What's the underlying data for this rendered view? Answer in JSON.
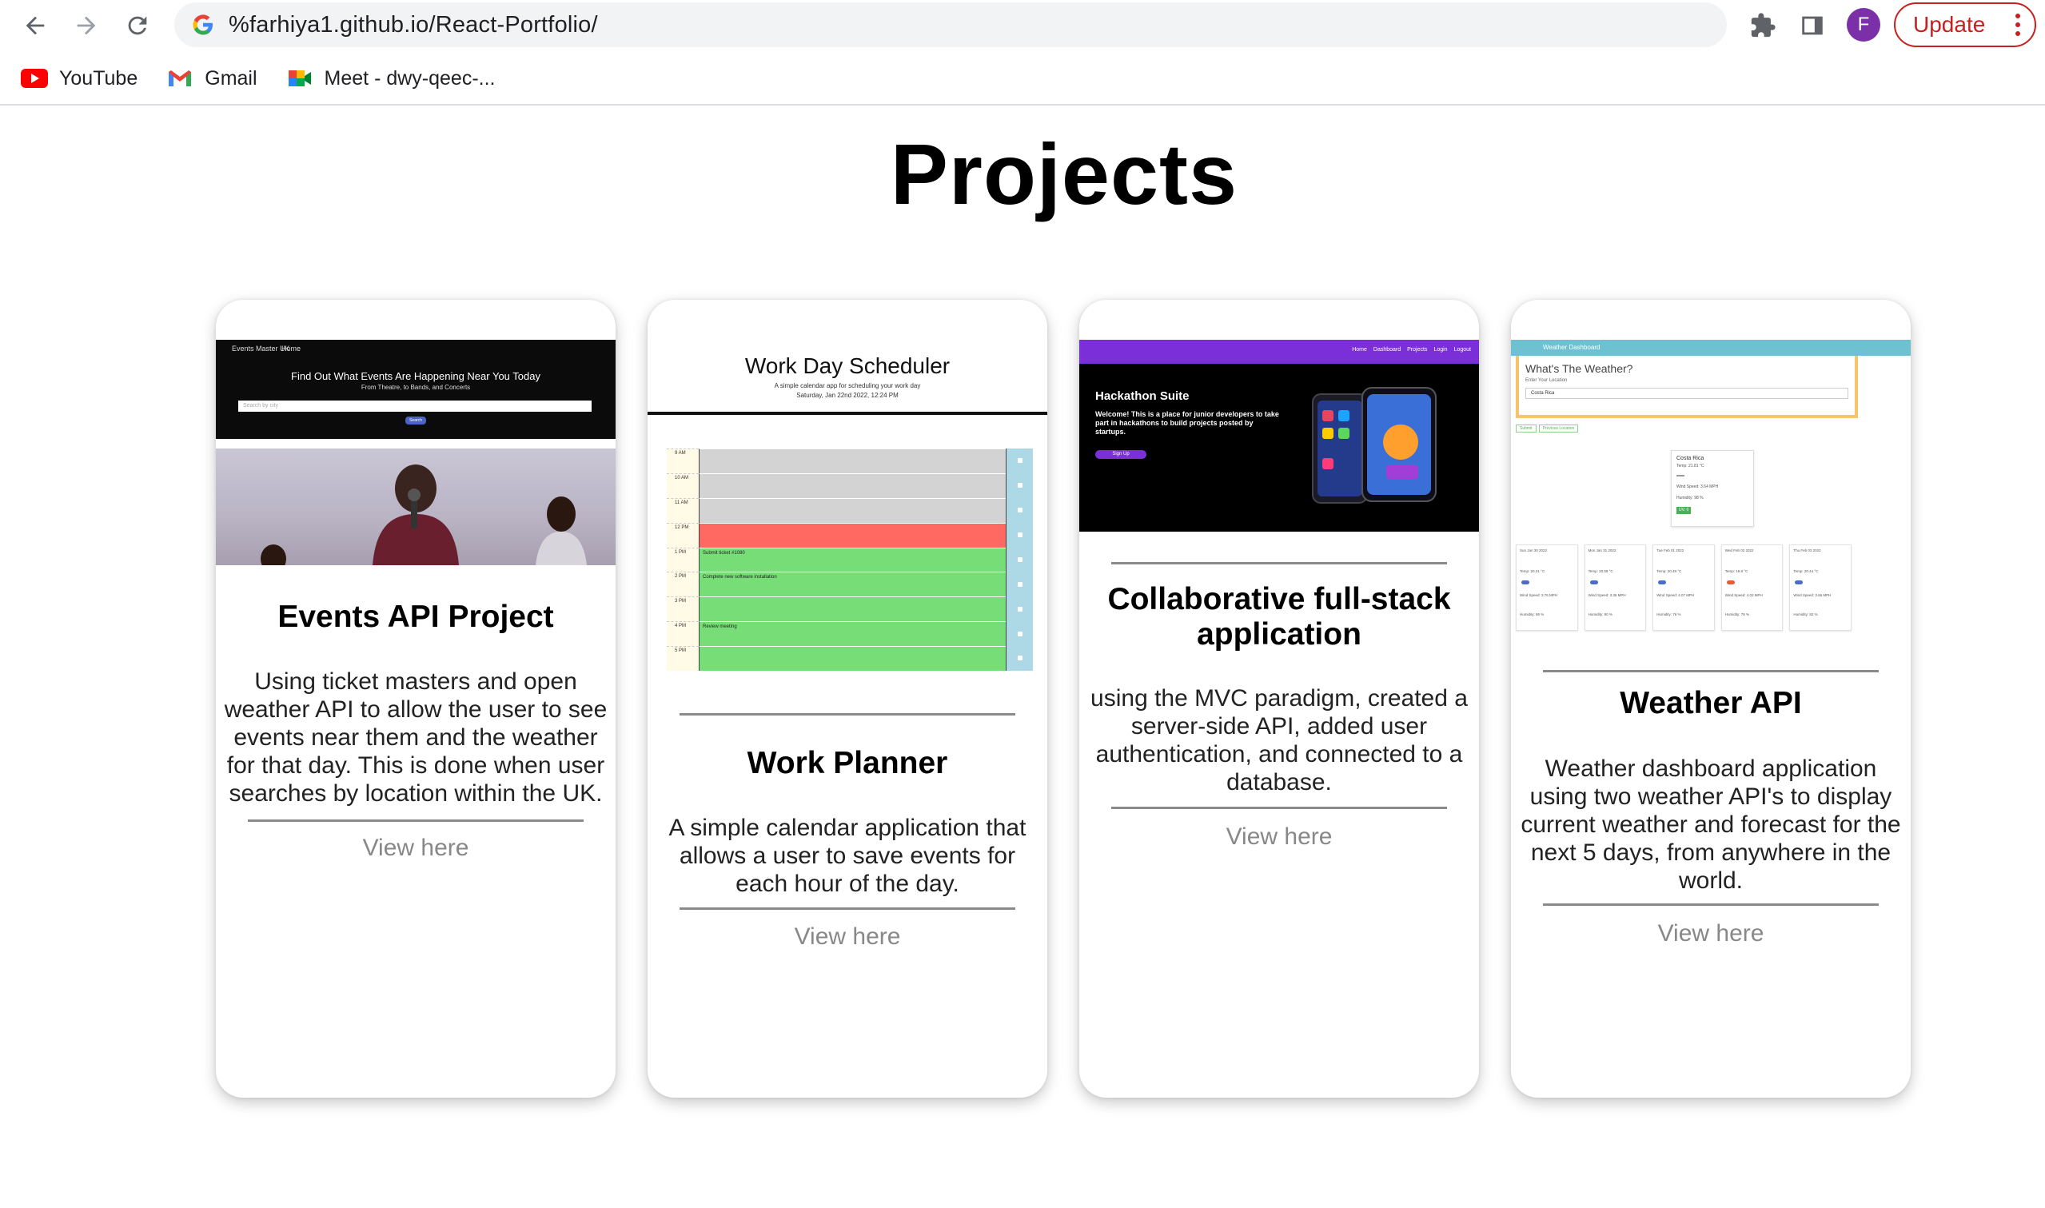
{
  "browser": {
    "url": "%farhiya1.github.io/React-Portfolio/",
    "update_label": "Update",
    "avatar_letter": "F",
    "bookmarks": [
      {
        "label": "YouTube"
      },
      {
        "label": "Gmail"
      },
      {
        "label": "Meet - dwy-qeec-..."
      }
    ]
  },
  "page": {
    "title": "Projects"
  },
  "projects": [
    {
      "title": "Events API Project",
      "description": "Using ticket masters and open weather API to allow the user to see events near them and the weather for that day. This is done when user searches by location within the UK.",
      "link_label": "View here",
      "preview": {
        "nav_brand": "Events Master UK",
        "nav_home": "Home",
        "heading": "Find Out What Events Are Happening Near You Today",
        "subheading": "From Theatre, to Bands, and Concerts",
        "search_placeholder": "Search by city",
        "button": "Search"
      }
    },
    {
      "title": "Work Planner",
      "description": "A simple calendar application that allows a user to save events for each hour of the day.",
      "link_label": "View here",
      "preview": {
        "heading": "Work Day Scheduler",
        "subheading": "A simple calendar app for scheduling your work day",
        "date": "Saturday, Jan 22nd 2022, 12:24 PM",
        "hours": [
          "9 AM",
          "10 AM",
          "11 AM",
          "12 PM",
          "1 PM",
          "2 PM",
          "3 PM",
          "4 PM",
          "5 PM"
        ],
        "events": [
          "",
          "",
          "",
          "",
          "Submit ticket #1080",
          "Complete new software installation",
          "",
          "Review meeting",
          ""
        ],
        "colors": {
          "past": "#d3d3d3",
          "present": "#ff6961",
          "future": "#77dd77",
          "save": "#add8e6"
        }
      }
    },
    {
      "title": "Collaborative full-stack application",
      "description": "using the MVC paradigm, created a server-side API, added user authentication, and connected to a database.",
      "link_label": "View here",
      "preview": {
        "nav_links": [
          "Home",
          "Dashboard",
          "Projects",
          "Login",
          "Logout"
        ],
        "heading": "Hackathon Suite",
        "body": "Welcome! This is a place for junior developers to take part in hackathons to build projects posted by startups.",
        "button": "Sign Up",
        "accent": "#7b2fd8"
      }
    },
    {
      "title": "Weather API",
      "description": "Weather dashboard application using two weather API's to display current weather and forecast for the next 5 days, from anywhere in the world.",
      "link_label": "View here",
      "preview": {
        "nav_title": "Weather Dashboard",
        "heading": "What's The Weather?",
        "input_label": "Enter Your Location",
        "input_value": "Costa Rica",
        "buttons": [
          "Submit",
          "Previous Location"
        ],
        "current_city": "Costa Rica",
        "current_lines": [
          "Temp: 21.81 °C",
          "Wind Speed: 3.64 MPH",
          "Humidity: 98 %"
        ],
        "uv_label": "UV: 0",
        "forecast": [
          {
            "date": "Sun Jan 30 2022",
            "temp": "Temp: 20.31 °C",
            "wind": "Wind Speed: 3.76 MPH",
            "hum": "Humidity: 86 %"
          },
          {
            "date": "Mon Jan 31 2022",
            "temp": "Temp: 20.59 °C",
            "wind": "Wind Speed: 3.36 MPH",
            "hum": "Humidity: 80 %"
          },
          {
            "date": "Tue Feb 01 2022",
            "temp": "Temp: 20.48 °C",
            "wind": "Wind Speed: 4.07 MPH",
            "hum": "Humidity: 76 %"
          },
          {
            "date": "Wed Feb 02 2022",
            "temp": "Temp: 19.8 °C",
            "wind": "Wind Speed: 4.02 MPH",
            "hum": "Humidity: 78 %"
          },
          {
            "date": "Thu Feb 03 2022",
            "temp": "Temp: 20.44 °C",
            "wind": "Wind Speed: 3.66 MPH",
            "hum": "Humidity: 82 %"
          }
        ],
        "colors": {
          "nav": "#6ec1d1",
          "panel_border": "#f7c46c",
          "uv_badge": "#4caf50"
        }
      }
    }
  ]
}
